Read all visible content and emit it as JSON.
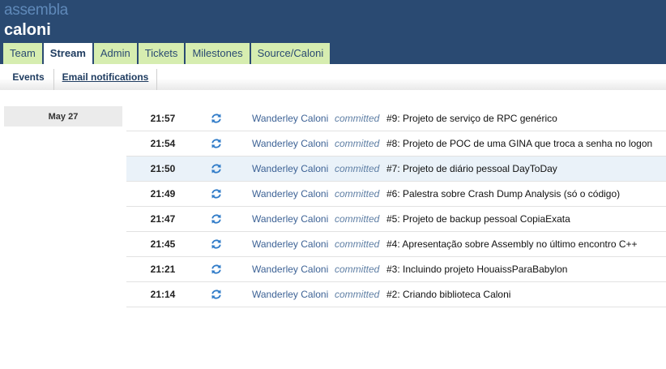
{
  "header": {
    "logo": "assembla",
    "space_title": "caloni"
  },
  "tabs": [
    {
      "label": "Team",
      "active": false
    },
    {
      "label": "Stream",
      "active": true
    },
    {
      "label": "Admin",
      "active": false
    },
    {
      "label": "Tickets",
      "active": false
    },
    {
      "label": "Milestones",
      "active": false
    },
    {
      "label": "Source/Caloni",
      "active": false
    }
  ],
  "subnav": {
    "events_label": "Events",
    "email_label": "Email notifications"
  },
  "stream": {
    "date": "May 27",
    "icon": "commit-refresh-icon",
    "icon_color": "#2f7bc8",
    "events": [
      {
        "time": "21:57",
        "author": "Wanderley Caloni",
        "action": "committed",
        "message": "#9: Projeto de serviço de RPC genérico"
      },
      {
        "time": "21:54",
        "author": "Wanderley Caloni",
        "action": "committed",
        "message": "#8: Projeto de POC de uma GINA que troca a senha no logon"
      },
      {
        "time": "21:50",
        "author": "Wanderley Caloni",
        "action": "committed",
        "message": "#7: Projeto de diário pessoal DayToDay"
      },
      {
        "time": "21:49",
        "author": "Wanderley Caloni",
        "action": "committed",
        "message": "#6: Palestra sobre Crash Dump Analysis (só o código)"
      },
      {
        "time": "21:47",
        "author": "Wanderley Caloni",
        "action": "committed",
        "message": "#5: Projeto de backup pessoal CopiaExata"
      },
      {
        "time": "21:45",
        "author": "Wanderley Caloni",
        "action": "committed",
        "message": "#4: Apresentação sobre Assembly no último encontro C++"
      },
      {
        "time": "21:21",
        "author": "Wanderley Caloni",
        "action": "committed",
        "message": "#3: Incluindo projeto HouaissParaBabylon"
      },
      {
        "time": "21:14",
        "author": "Wanderley Caloni",
        "action": "committed",
        "message": "#2: Criando biblioteca Caloni"
      }
    ]
  }
}
